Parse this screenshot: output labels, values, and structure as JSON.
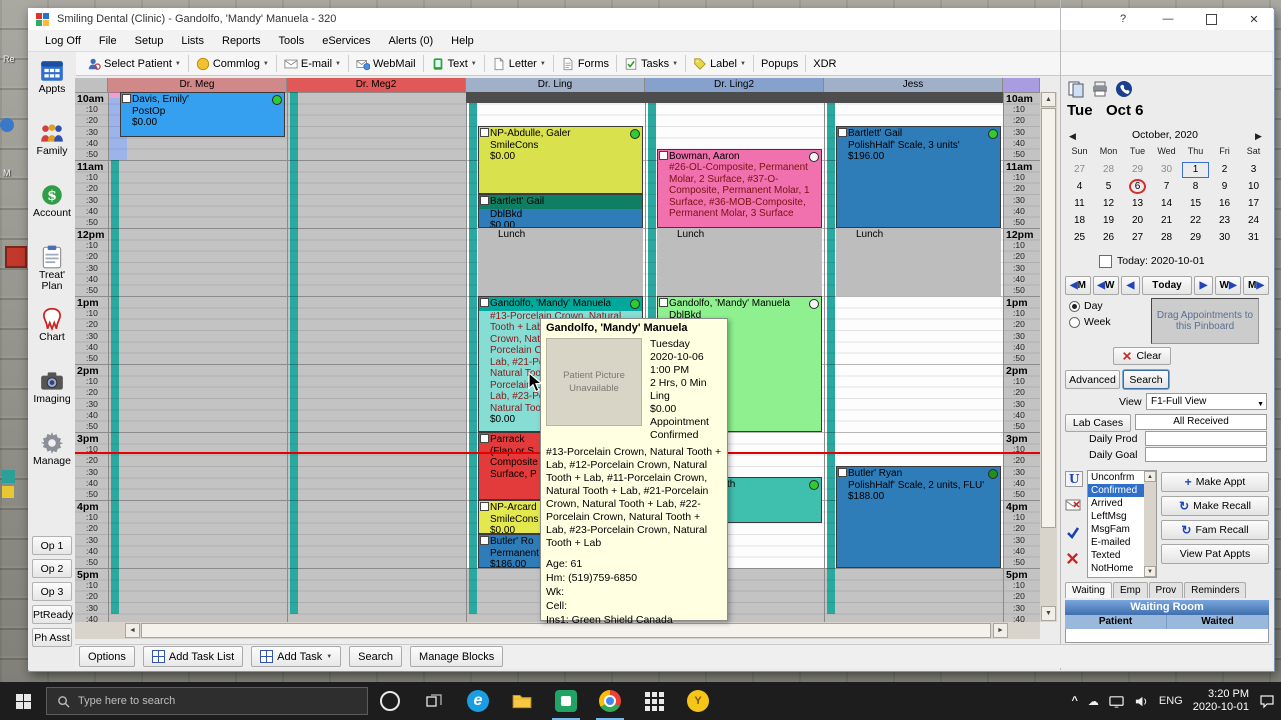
{
  "window": {
    "title": "Smiling Dental (Clinic) - Gandolfo, 'Mandy' Manuela - 320",
    "help": "?",
    "close": "✕"
  },
  "menu": {
    "items": [
      "Log Off",
      "File",
      "Setup",
      "Lists",
      "Reports",
      "Tools",
      "eServices",
      "Alerts (0)",
      "Help"
    ]
  },
  "toolbar": {
    "buttons": [
      {
        "label": "Select Patient",
        "icon": "patient",
        "arrow": true
      },
      {
        "label": "Commlog",
        "icon": "commlog",
        "arrow": true
      },
      {
        "label": "E-mail",
        "icon": "email",
        "arrow": true
      },
      {
        "label": "WebMail",
        "icon": "webmail",
        "arrow": false
      },
      {
        "label": "Text",
        "icon": "text",
        "arrow": true
      },
      {
        "label": "Letter",
        "icon": "letter",
        "arrow": true
      },
      {
        "label": "Forms",
        "icon": "forms",
        "arrow": false
      },
      {
        "label": "Tasks",
        "icon": "tasks",
        "arrow": true
      },
      {
        "label": "Label",
        "icon": "tag",
        "arrow": true
      },
      {
        "label": "Popups",
        "icon": null,
        "arrow": false
      },
      {
        "label": "XDR",
        "icon": null,
        "arrow": false
      }
    ]
  },
  "modules": {
    "items": [
      {
        "label": "Appts",
        "icon": "appts"
      },
      {
        "label": "Family",
        "icon": "family"
      },
      {
        "label": "Account",
        "icon": "account"
      },
      {
        "label": "Treat' Plan",
        "icon": "treatplan"
      },
      {
        "label": "Chart",
        "icon": "chart"
      },
      {
        "label": "Imaging",
        "icon": "imaging"
      },
      {
        "label": "Manage",
        "icon": "manage"
      }
    ]
  },
  "op_buttons": [
    "Op 1",
    "Op 2",
    "Op 3",
    "PtReady",
    "Ph Asst"
  ],
  "schedule": {
    "operatories": [
      {
        "name": "Dr. Meg",
        "header_color": "#d08888"
      },
      {
        "name": "Dr. Meg2",
        "header_color": "#e05858"
      },
      {
        "name": "Dr. Ling",
        "header_color": "#9fb0c8"
      },
      {
        "name": "Dr. Ling2",
        "header_color": "#86a2cc"
      },
      {
        "name": "Jess",
        "header_color": "#9fb0c8"
      }
    ],
    "hours": [
      "10am",
      "11am",
      "12pm",
      "1pm",
      "2pm",
      "3pm",
      "4pm",
      "5pm"
    ],
    "minutes": [
      ":10",
      ":20",
      ":30",
      ":40",
      ":50"
    ],
    "open_columns": [
      2,
      3,
      4
    ],
    "blockouts": [
      {
        "cols": [
          2,
          3,
          4
        ],
        "start": "10:00",
        "end": "10:10",
        "color": "#4d4d4d",
        "label": "",
        "full": true
      },
      {
        "cols": [
          2
        ],
        "start": "12:00",
        "end": "13:00",
        "color": "#bdbdbd",
        "label": "Lunch"
      },
      {
        "cols": [
          3
        ],
        "start": "12:00",
        "end": "13:00",
        "color": "#bdbdbd",
        "label": "Lunch"
      },
      {
        "cols": [
          4
        ],
        "start": "12:00",
        "end": "13:00",
        "color": "#bdbdbd",
        "label": "Lunch"
      }
    ],
    "strip_blockouts": [
      {
        "col": 0,
        "start": "10:00",
        "end": "11:00",
        "color": "#9db4ea"
      },
      {
        "col": 0,
        "start": "10:00",
        "end": "10:05",
        "color": "#f0a0c8"
      }
    ],
    "appointments": [
      {
        "col": 0,
        "start": "10:00",
        "end": "10:40",
        "color": "#35a0f0",
        "name": "Davis, Emily'",
        "detail": "PostOp",
        "amount": "$0.00",
        "dot": "#2ecc2e",
        "checkbox": true
      },
      {
        "col": 2,
        "start": "10:30",
        "end": "11:30",
        "color": "#d9e14d",
        "name": "NP-Abdulle, Galer",
        "detail": "SmileCons",
        "amount": "$0.00",
        "dot": "#2ecc2e",
        "checkbox": true
      },
      {
        "col": 2,
        "start": "11:30",
        "end": "12:00",
        "color": "#2e7cb8",
        "header_color": "#0e7f63",
        "name": "Bartlett' Gail",
        "detail": "DblBkd",
        "amount": "$0.00",
        "checkbox": true
      },
      {
        "col": 3,
        "start": "10:50",
        "end": "12:00",
        "color": "#f071ae",
        "name": "Bowman, Aaron",
        "detail": "#26-OL-Composite, Permanent Molar, 2 Surface, #37-O-Composite, Permanent Molar, 1 Surface, #36-MOB-Composite, Permanent Molar, 3 Surface",
        "detail_color": "#7a1212",
        "dot": "#f5f5f5",
        "checkbox": true
      },
      {
        "col": 4,
        "start": "10:30",
        "end": "12:00",
        "color": "#2e7cb8",
        "name": "Bartlett' Gail",
        "detail": "PolishHalf' Scale, 3 units'",
        "amount": "$196.00",
        "dot": "#2ecc2e",
        "checkbox": true
      },
      {
        "col": 2,
        "start": "13:00",
        "end": "15:00",
        "color": "#86ddd4",
        "header_color": "#00a99c",
        "name": "Gandolfo, 'Mandy' Manuela",
        "detail": "#13-Porcelain Crown, Natural Tooth + Lab, #12-Porcelain Crown, Natural Tooth + Lab, #11-Porcelain Crown, Natural Tooth + Lab, #21-Porcelain Crown, Natural Tooth + Lab, #22-Porcelain Crown, Natural Tooth + Lab, #23-Porcelain Crown, Natural Tooth + Lab",
        "detail_color": "#8b1a1a",
        "amount": "$0.00",
        "dot": "#2ecc2e",
        "checkbox": true
      },
      {
        "col": 3,
        "start": "13:00",
        "end": "15:00",
        "color": "#8ef08e",
        "name": "Gandolfo, 'Mandy' Manuela",
        "detail": "DblBkd",
        "dot": "#f5f5f5",
        "checkbox": true
      },
      {
        "col": 2,
        "start": "15:00",
        "end": "16:00",
        "color": "#e33b3b",
        "lines": [
          "Parrack",
          "(Flap or S",
          "Composite",
          "Surface, P"
        ],
        "checkbox": true
      },
      {
        "col": 2,
        "start": "16:00",
        "end": "16:30",
        "color": "#e3e84e",
        "name": "NP-Arcard",
        "detail": "SmileCons",
        "amount": "$0.00",
        "checkbox": true
      },
      {
        "col": 2,
        "start": "16:30",
        "end": "17:00",
        "color": "#2e7cb8",
        "lines": [
          "Butler' Ro",
          "Permanent",
          "$186.00"
        ],
        "checkbox": true
      },
      {
        "col": 3,
        "start": "15:40",
        "end": "16:20",
        "color": "#3fbfae",
        "lines": [
          "th"
        ],
        "indent": 58,
        "dot": "#2ecc2e",
        "checkbox": true
      },
      {
        "col": 4,
        "start": "15:30",
        "end": "17:00",
        "color": "#2e7cb8",
        "name": "Butler' Ryan",
        "detail": "PolishHalf' Scale, 2 units, FLU'",
        "amount": "$188.00",
        "dot": "#1f8f1f",
        "checkbox": true
      }
    ]
  },
  "tooltip": {
    "title": "Gandolfo, 'Mandy' Manuela",
    "photo_text": "Patient Picture Unavailable",
    "info": [
      "Tuesday",
      "2020-10-06",
      "1:00 PM",
      "2 Hrs, 0 Min",
      "Ling",
      "$0.00",
      "Appointment Confirmed"
    ],
    "procedures": "#13-Porcelain Crown, Natural Tooth + Lab, #12-Porcelain Crown, Natural Tooth + Lab, #11-Porcelain Crown, Natural Tooth + Lab, #21-Porcelain Crown, Natural Tooth + Lab, #22-Porcelain Crown, Natural Tooth + Lab, #23-Porcelain Crown, Natural Tooth + Lab",
    "age": "Age: 61",
    "hm": "Hm: (519)759-6850",
    "wk": "Wk:",
    "cell": "Cell:",
    "ins": "Ins1: Green Shield Canada"
  },
  "right_panel": {
    "weekday": "Tue",
    "date_label": "Oct 6",
    "calendar": {
      "prev": "◀",
      "next": "▶",
      "month": "October, 2020",
      "day_names": [
        "Sun",
        "Mon",
        "Tue",
        "Wed",
        "Thu",
        "Fri",
        "Sat"
      ],
      "weeks": [
        [
          27,
          28,
          29,
          30,
          1,
          2,
          3
        ],
        [
          4,
          5,
          6,
          7,
          8,
          9,
          10
        ],
        [
          11,
          12,
          13,
          14,
          15,
          16,
          17
        ],
        [
          18,
          19,
          20,
          21,
          22,
          23,
          24
        ],
        [
          25,
          26,
          27,
          28,
          29,
          30,
          31
        ]
      ],
      "today_day": 1,
      "selected_day": 6,
      "today_label": "Today: 2020-10-01"
    },
    "nav": {
      "prev": [
        "◀M",
        "◀W",
        "◀"
      ],
      "today": "Today",
      "next": [
        "▶",
        "W▶",
        "M▶"
      ]
    },
    "mode": {
      "day": "Day",
      "week": "Week"
    },
    "pinboard": "Drag Appointments to this Pinboard",
    "clear": "Clear",
    "advanced": "Advanced",
    "search": "Search",
    "view_label": "View",
    "view_value": "F1-Full View",
    "lab_cases": "Lab Cases",
    "lab_status": "All Received",
    "daily_prod": "Daily Prod",
    "daily_goal": "Daily Goal",
    "statuses": [
      "Unconfrm",
      "Confirmed",
      "Arrived",
      "LeftMsg",
      "MsgFam",
      "E-mailed",
      "Texted",
      "NotHome"
    ],
    "selected_status": "Confirmed",
    "actions": [
      "Make Appt",
      "Make Recall",
      "Fam Recall",
      "View Pat Appts"
    ],
    "tabs": [
      "Waiting",
      "Emp",
      "Prov",
      "Reminders"
    ],
    "waiting_room": {
      "title": "Waiting Room",
      "col1": "Patient",
      "col2": "Waited"
    }
  },
  "bottom_bar": {
    "items": [
      {
        "label": "Options"
      },
      {
        "label": "Add Task List",
        "icon": "grid"
      },
      {
        "label": "Add Task",
        "icon": "grid",
        "arrow": true
      },
      {
        "label": "Search"
      },
      {
        "label": "Manage Blocks"
      }
    ]
  },
  "taskbar": {
    "search_placeholder": "Type here to search",
    "lang": "ENG",
    "time": "3:20 PM",
    "date": "2020-10-01"
  },
  "desktop": {
    "fragments": [
      "Re",
      "M"
    ]
  }
}
